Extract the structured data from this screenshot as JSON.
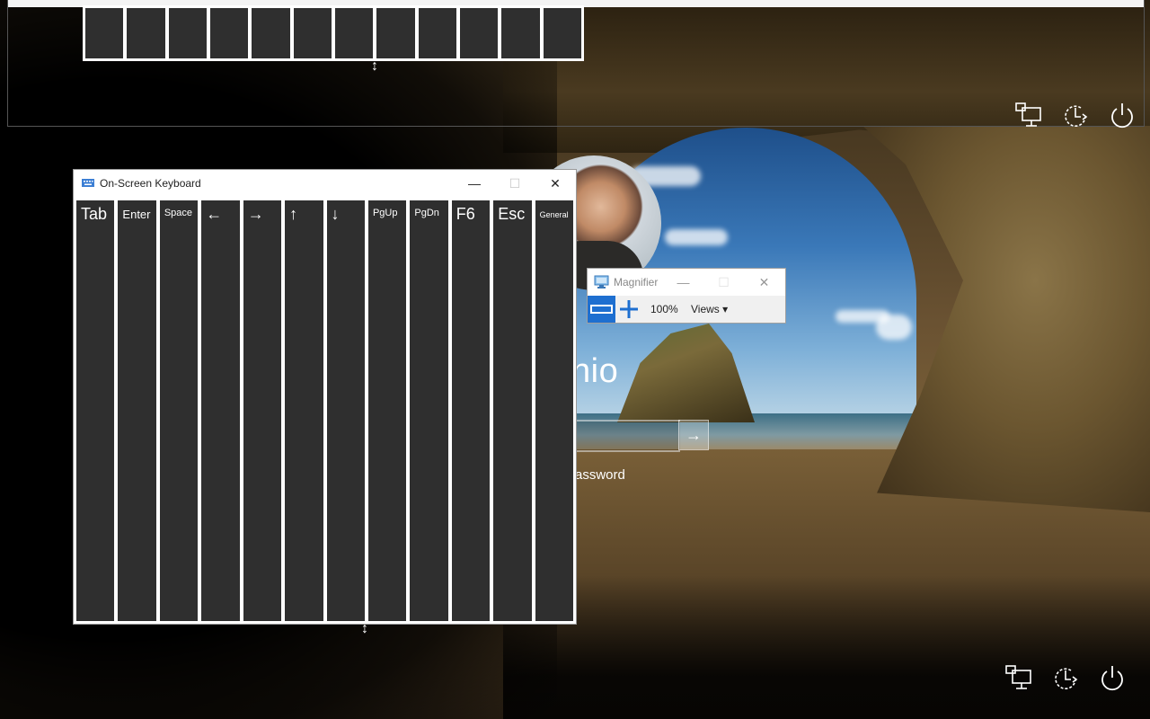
{
  "login": {
    "user_name_partial": "hio",
    "password_hint_partial": "assword",
    "submit_glyph": "→"
  },
  "magnifier_pane": {
    "key_count": 12,
    "resize_glyph": "↕"
  },
  "osk": {
    "title": "On-Screen Keyboard",
    "minimize_glyph": "—",
    "maximize_glyph": "☐",
    "close_glyph": "✕",
    "resize_glyph": "↕",
    "keys": [
      {
        "label": "Tab",
        "size": "big"
      },
      {
        "label": "Enter",
        "size": "med"
      },
      {
        "label": "Space",
        "size": "small"
      },
      {
        "label": "←",
        "size": "big"
      },
      {
        "label": "→",
        "size": "big"
      },
      {
        "label": "↑",
        "size": "big"
      },
      {
        "label": "↓",
        "size": "big"
      },
      {
        "label": "PgUp",
        "size": "small"
      },
      {
        "label": "PgDn",
        "size": "small"
      },
      {
        "label": "F6",
        "size": "big"
      },
      {
        "label": "Esc",
        "size": "big"
      },
      {
        "label": "General",
        "size": "tiny"
      }
    ]
  },
  "magnifier": {
    "title": "Magnifier",
    "minimize_glyph": "—",
    "maximize_glyph": "☐",
    "close_glyph": "✕",
    "zoom_level": "100%",
    "views_label": "Views ▾",
    "accent_color": "#1e6fd0"
  },
  "tray_icons": [
    "network-icon",
    "ease-of-access-icon",
    "power-icon"
  ]
}
